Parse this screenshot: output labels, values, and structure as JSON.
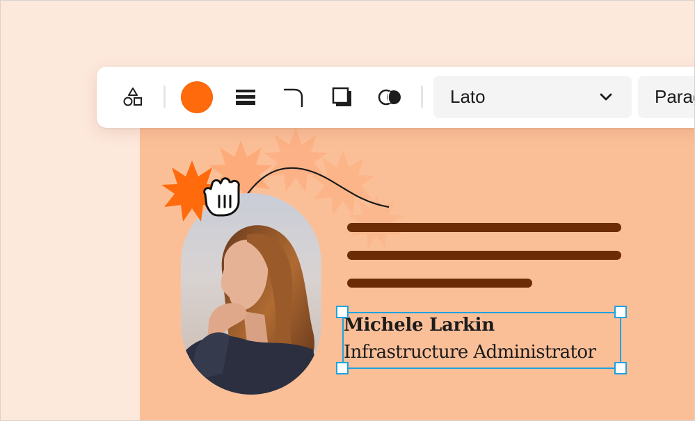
{
  "toolbar": {
    "tools": [
      {
        "name": "shapes-icon"
      },
      {
        "name": "fill-color"
      },
      {
        "name": "stroke-weight-icon"
      },
      {
        "name": "corner-radius-icon"
      },
      {
        "name": "shadow-icon"
      },
      {
        "name": "blend-opacity-icon"
      }
    ],
    "fill_color": "#ff6a0c",
    "font_family_value": "Lato",
    "text_style_value": "Paragraph"
  },
  "card": {
    "background": "#fbbf98",
    "line_color": "#6b2c06",
    "profile_name": "Michele Larkin",
    "profile_role": "Infrastructure Administrator"
  },
  "colors": {
    "accent": "#ff6a0c",
    "selection": "#1fa2e0",
    "page_background": "#fde8dc"
  }
}
